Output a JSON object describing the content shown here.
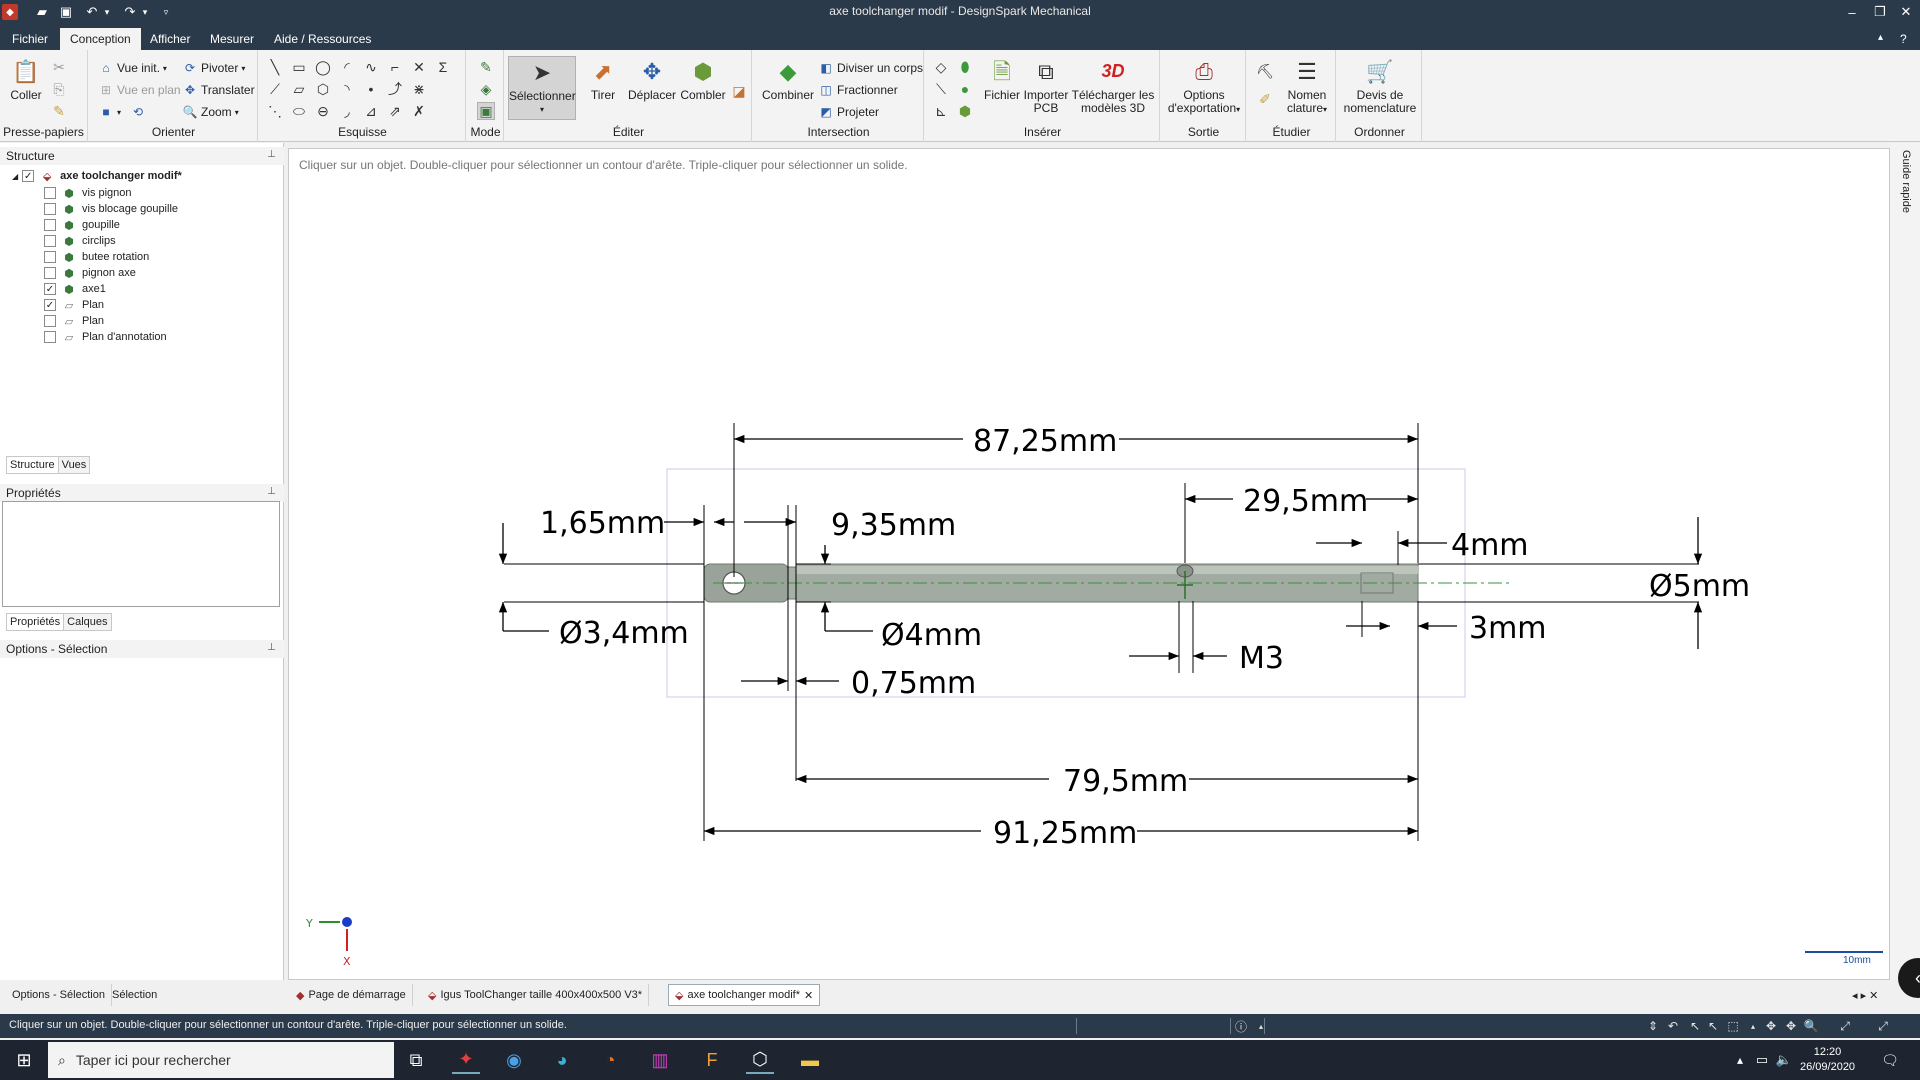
{
  "window": {
    "title": "axe toolchanger modif - DesignSpark Mechanical"
  },
  "menu": {
    "tabs": [
      "Fichier",
      "Conception",
      "Afficher",
      "Mesurer",
      "Aide / Ressources"
    ],
    "active": "Conception"
  },
  "ribbon": {
    "clipboard": {
      "paste": "Coller",
      "group": "Presse-papiers"
    },
    "orient": {
      "home_view": "Vue init.",
      "plan_view": "Vue en plan",
      "rotate": "Pivoter",
      "translate": "Translater",
      "zoom": "Zoom",
      "group": "Orienter"
    },
    "sketch": {
      "group": "Esquisse"
    },
    "mode": {
      "group": "Mode"
    },
    "edit": {
      "select": "Sélectionner",
      "pull": "Tirer",
      "move": "Déplacer",
      "fill": "Combler",
      "group": "Éditer"
    },
    "intersect": {
      "combine": "Combiner",
      "split_body": "Diviser un corps",
      "split": "Fractionner",
      "project": "Projeter",
      "group": "Intersection"
    },
    "insert": {
      "file": "Fichier",
      "import_pcb_1": "Importer",
      "import_pcb_2": "PCB",
      "download_1": "Télécharger les",
      "download_2": "modèles 3D",
      "logo_3d": "3D",
      "group": "Insérer"
    },
    "output": {
      "export_1": "Options",
      "export_2": "d'exportation",
      "group": "Sortie"
    },
    "study": {
      "bom_1": "Nomen",
      "bom_2": "clature",
      "group": "Étudier"
    },
    "order": {
      "quote_1": "Devis de",
      "quote_2": "nomenclature",
      "group": "Ordonner"
    }
  },
  "structure": {
    "header": "Structure",
    "root": "axe toolchanger modif*",
    "items": [
      {
        "label": "vis pignon",
        "checked": false
      },
      {
        "label": "vis blocage goupille",
        "checked": false
      },
      {
        "label": "goupille",
        "checked": false
      },
      {
        "label": "circlips",
        "checked": false
      },
      {
        "label": "butee rotation",
        "checked": false
      },
      {
        "label": "pignon axe",
        "checked": false
      },
      {
        "label": "axe1",
        "checked": true
      },
      {
        "label": "Plan",
        "checked": true
      },
      {
        "label": "Plan",
        "checked": false
      },
      {
        "label": "Plan d'annotation",
        "checked": false
      }
    ],
    "tabs": [
      "Structure",
      "Vues"
    ]
  },
  "properties": {
    "header": "Propriétés",
    "tabs": [
      "Propriétés",
      "Calques"
    ]
  },
  "options": {
    "header": "Options - Sélection"
  },
  "viewport": {
    "hint": "Cliquer sur un objet. Double-cliquer pour sélectionner un contour d'arête. Triple-cliquer pour sélectionner un solide.",
    "scale": "10mm",
    "triad_y": "Y",
    "triad_x": "X",
    "dimensions": {
      "overall_top": "87,25mm",
      "right_offset": "29,5mm",
      "end_groove": "4mm",
      "diameter_right": "Ø5mm",
      "left_step": "1,65mm",
      "hole_offset": "9,35mm",
      "diameter_left": "Ø3,4mm",
      "diameter_mid": "Ø4mm",
      "groove": "0,75mm",
      "thread": "M3",
      "end_len": "3mm",
      "inner_len": "79,5mm",
      "overall_bottom": "91,25mm"
    }
  },
  "guide": {
    "label": "Guide rapide"
  },
  "bottom_tabs": {
    "left_1": "Options - Sélection",
    "left_2": "Sélection",
    "docs": [
      "Page de démarrage",
      "Igus ToolChanger  taille 400x400x500 V3*",
      "axe toolchanger modif*"
    ]
  },
  "status": {
    "text": "Cliquer sur un objet. Double-cliquer pour sélectionner un contour d'arête. Triple-cliquer pour sélectionner un solide."
  },
  "taskbar": {
    "search_placeholder": "Taper ici pour rechercher",
    "time": "12:20",
    "date": "26/09/2020"
  }
}
